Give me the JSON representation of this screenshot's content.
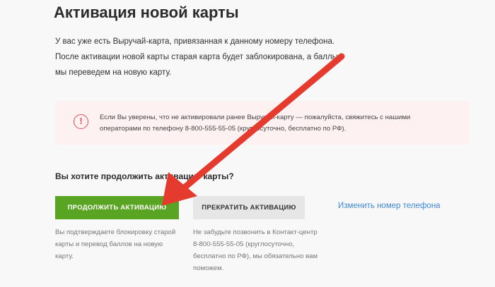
{
  "title": "Активация новой карты",
  "intro": [
    "У вас уже есть Выручай-карта, привязанная к данному номеру телефона.",
    "После активации новой карты старая карта будет заблокирована, а баллы",
    "мы переведем на новую карту."
  ],
  "alert": {
    "icon": "exclamation-circle-icon",
    "lines": [
      "Если Вы уверены, что не активировали ранее Выручай-карту — пожалуйста, свяжитесь с нашими",
      "операторами по телефону 8-800-555-55-05 (круглосуточно, бесплатно по РФ)."
    ],
    "colors": {
      "background": "#fdf1f1",
      "icon": "#e04e4e"
    }
  },
  "question": "Вы хотите продолжить активацию карты?",
  "actions": {
    "continue_label": "ПРОДОЛЖИТЬ АКТИВАЦИЮ",
    "stop_label": "ПРЕКРАТИТЬ АКТИВАЦИЮ",
    "change_phone_label": "Изменить номер телефона"
  },
  "hints": {
    "continue": [
      "Вы подтверждаете блокировку старой",
      "карты и перевод баллов на новую",
      "карту."
    ],
    "stop": [
      "Не забудьте позвонить в Контакт-центр",
      "8-800-555-55-05 (круглосуточно,",
      "бесплатно по РФ), мы обязательно вам",
      "поможем."
    ]
  },
  "colors": {
    "primary_button": "#5aa423",
    "secondary_button": "#e6e6e6",
    "link": "#3e89d6",
    "annotation_arrow": "#e53a2e"
  },
  "annotation": {
    "icon": "red-arrow-icon"
  }
}
